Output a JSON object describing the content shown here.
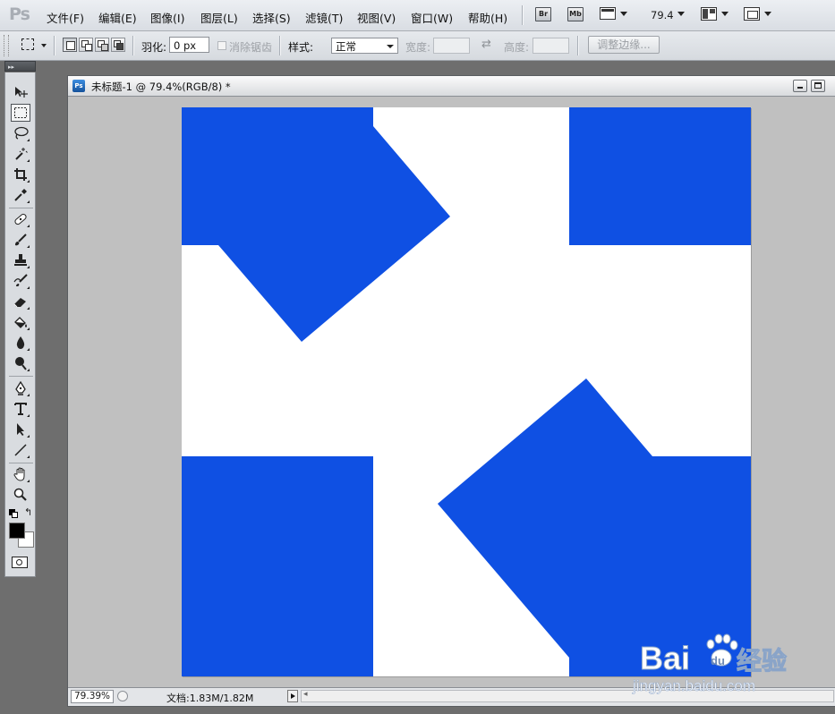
{
  "app": {
    "logo_text": "Ps"
  },
  "menu": {
    "items": [
      "文件(F)",
      "编辑(E)",
      "图像(I)",
      "图层(L)",
      "选择(S)",
      "滤镜(T)",
      "视图(V)",
      "窗口(W)",
      "帮助(H)"
    ],
    "bridge_label": "Br",
    "minibridge_label": "Mb",
    "zoom_value": "79.4"
  },
  "options": {
    "feather_label": "羽化:",
    "feather_value": "0 px",
    "antialias_label": "消除锯齿",
    "style_label": "样式:",
    "style_value": "正常",
    "width_label": "宽度:",
    "height_label": "高度:",
    "refine_edge_label": "调整边缘..."
  },
  "toolbox": {
    "tools": [
      {
        "name": "move-tool",
        "icon": "move-icon"
      },
      {
        "name": "rect-marquee-tool",
        "icon": "marquee-icon",
        "selected": true
      },
      {
        "name": "lasso-tool",
        "icon": "lasso-icon"
      },
      {
        "name": "magic-wand-tool",
        "icon": "magic-wand-icon"
      },
      {
        "name": "crop-tool",
        "icon": "crop-icon"
      },
      {
        "name": "eyedropper-tool",
        "icon": "eyedropper-icon"
      },
      {
        "name": "healing-brush-tool",
        "icon": "bandage-icon"
      },
      {
        "name": "brush-tool",
        "icon": "brush-icon"
      },
      {
        "name": "clone-stamp-tool",
        "icon": "stamp-icon"
      },
      {
        "name": "history-brush-tool",
        "icon": "history-brush-icon"
      },
      {
        "name": "eraser-tool",
        "icon": "eraser-icon"
      },
      {
        "name": "paint-bucket-tool",
        "icon": "bucket-icon"
      },
      {
        "name": "blur-tool",
        "icon": "drop-icon"
      },
      {
        "name": "dodge-tool",
        "icon": "dodge-icon"
      },
      {
        "name": "pen-tool",
        "icon": "pen-icon"
      },
      {
        "name": "type-tool",
        "icon": "type-icon"
      },
      {
        "name": "path-selection-tool",
        "icon": "arrow-icon"
      },
      {
        "name": "line-tool",
        "icon": "line-icon"
      },
      {
        "name": "hand-tool",
        "icon": "hand-icon"
      },
      {
        "name": "zoom-tool",
        "icon": "magnifier-icon"
      }
    ],
    "foreground_color": "#000000",
    "background_color": "#ffffff"
  },
  "document": {
    "title": "未标题-1 @ 79.4%(RGB/8) *",
    "zoom": "79.39%",
    "info": "文档:1.83M/1.82M",
    "fill_color": "#0f50e3"
  },
  "watermark": {
    "brand": "Bai",
    "brand_tail": "du",
    "suffix": "经验",
    "url": "jingyan.baidu.com"
  }
}
